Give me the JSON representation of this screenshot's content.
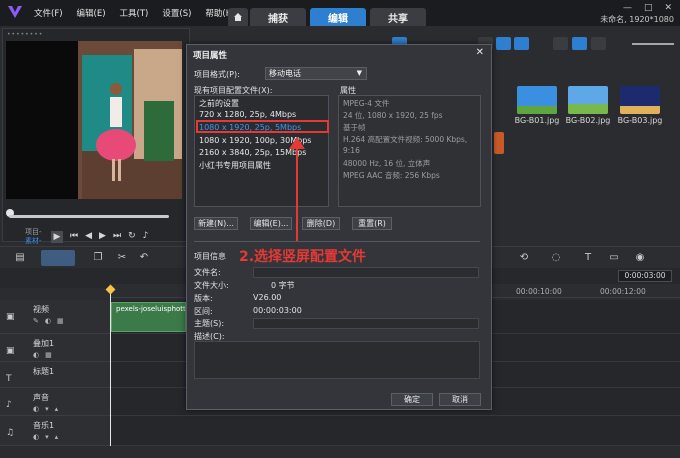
{
  "app": {
    "menu": [
      "文件(F)",
      "编辑(E)",
      "工具(T)",
      "设置(S)",
      "帮助(H)"
    ],
    "tabs": [
      {
        "label": "捕获",
        "active": false
      },
      {
        "label": "编辑",
        "active": true
      },
      {
        "label": "共享",
        "active": false
      }
    ],
    "project_info": "未命名, 1920*1080",
    "accent_color": "#2f7fd0"
  },
  "player": {
    "mode_project": "项目-",
    "mode_clip": "素材-",
    "controls": [
      "play-icon",
      "start-icon",
      "prev-frame-icon",
      "next-frame-icon",
      "end-icon",
      "repeat-icon",
      "volume-icon"
    ]
  },
  "library": {
    "add_label": "添加",
    "thumbnails": [
      {
        "label": "BG-B01.jpg",
        "icon": "landscape-sky-icon"
      },
      {
        "label": "BG-B02.jpg",
        "icon": "landscape-field-icon"
      },
      {
        "label": "BG-B03.jpg",
        "icon": "landscape-night-icon"
      }
    ]
  },
  "timeline": {
    "timecode": "0:00:03:00",
    "ruler": [
      "00:00:10:00",
      "00:00:12:00"
    ],
    "tracks": [
      {
        "name": "视频",
        "icon": "video-track-icon"
      },
      {
        "name": "叠加1",
        "icon": "overlay-track-icon"
      },
      {
        "name": "标题1",
        "icon": "title-track-icon"
      },
      {
        "name": "声音",
        "icon": "voice-track-icon"
      },
      {
        "name": "音乐1",
        "icon": "music-track-icon"
      }
    ],
    "clip_label": "pexels-joseluisphotto"
  },
  "dialog": {
    "title": "项目属性",
    "format_label": "项目格式(P):",
    "format_value": "移动电话",
    "profiles_label": "现有项目配置文件(X):",
    "properties_label": "属性",
    "profiles": [
      "之前的设置",
      "720 x 1280, 25p, 4Mbps",
      "1080 x 1920, 25p, 5Mbps",
      "1080 x 1920, 100p, 30Mbps",
      "2160 x 3840, 25p, 15Mbps",
      "小红书专用项目属性"
    ],
    "selected_profile_index": 2,
    "properties": [
      "MPEG-4 文件",
      "24 位, 1080 x 1920, 25 fps",
      "基于帧",
      "H.264 高配置文件视频: 5000 Kbps,",
      "9:16",
      "48000 Hz, 16 位, 立体声",
      "MPEG AAC 音频: 256 Kbps"
    ],
    "buttons": {
      "new": "新建(N)...",
      "edit": "编辑(E)...",
      "delete": "删除(D)",
      "reset": "重置(R)"
    },
    "info_title": "项目信息",
    "info": {
      "filename_label": "文件名:",
      "filesize_label": "文件大小:",
      "filesize_value": "0 字节",
      "version_label": "版本:",
      "version_value": "V26.00",
      "duration_label": "区间:",
      "duration_value": "00:00:03:00",
      "subject_label": "主题(S):",
      "description_label": "描述(C):"
    },
    "ok": "确定",
    "cancel": "取消"
  },
  "annotation": {
    "text": "2.选择竖屏配置文件",
    "color": "#e53935"
  }
}
